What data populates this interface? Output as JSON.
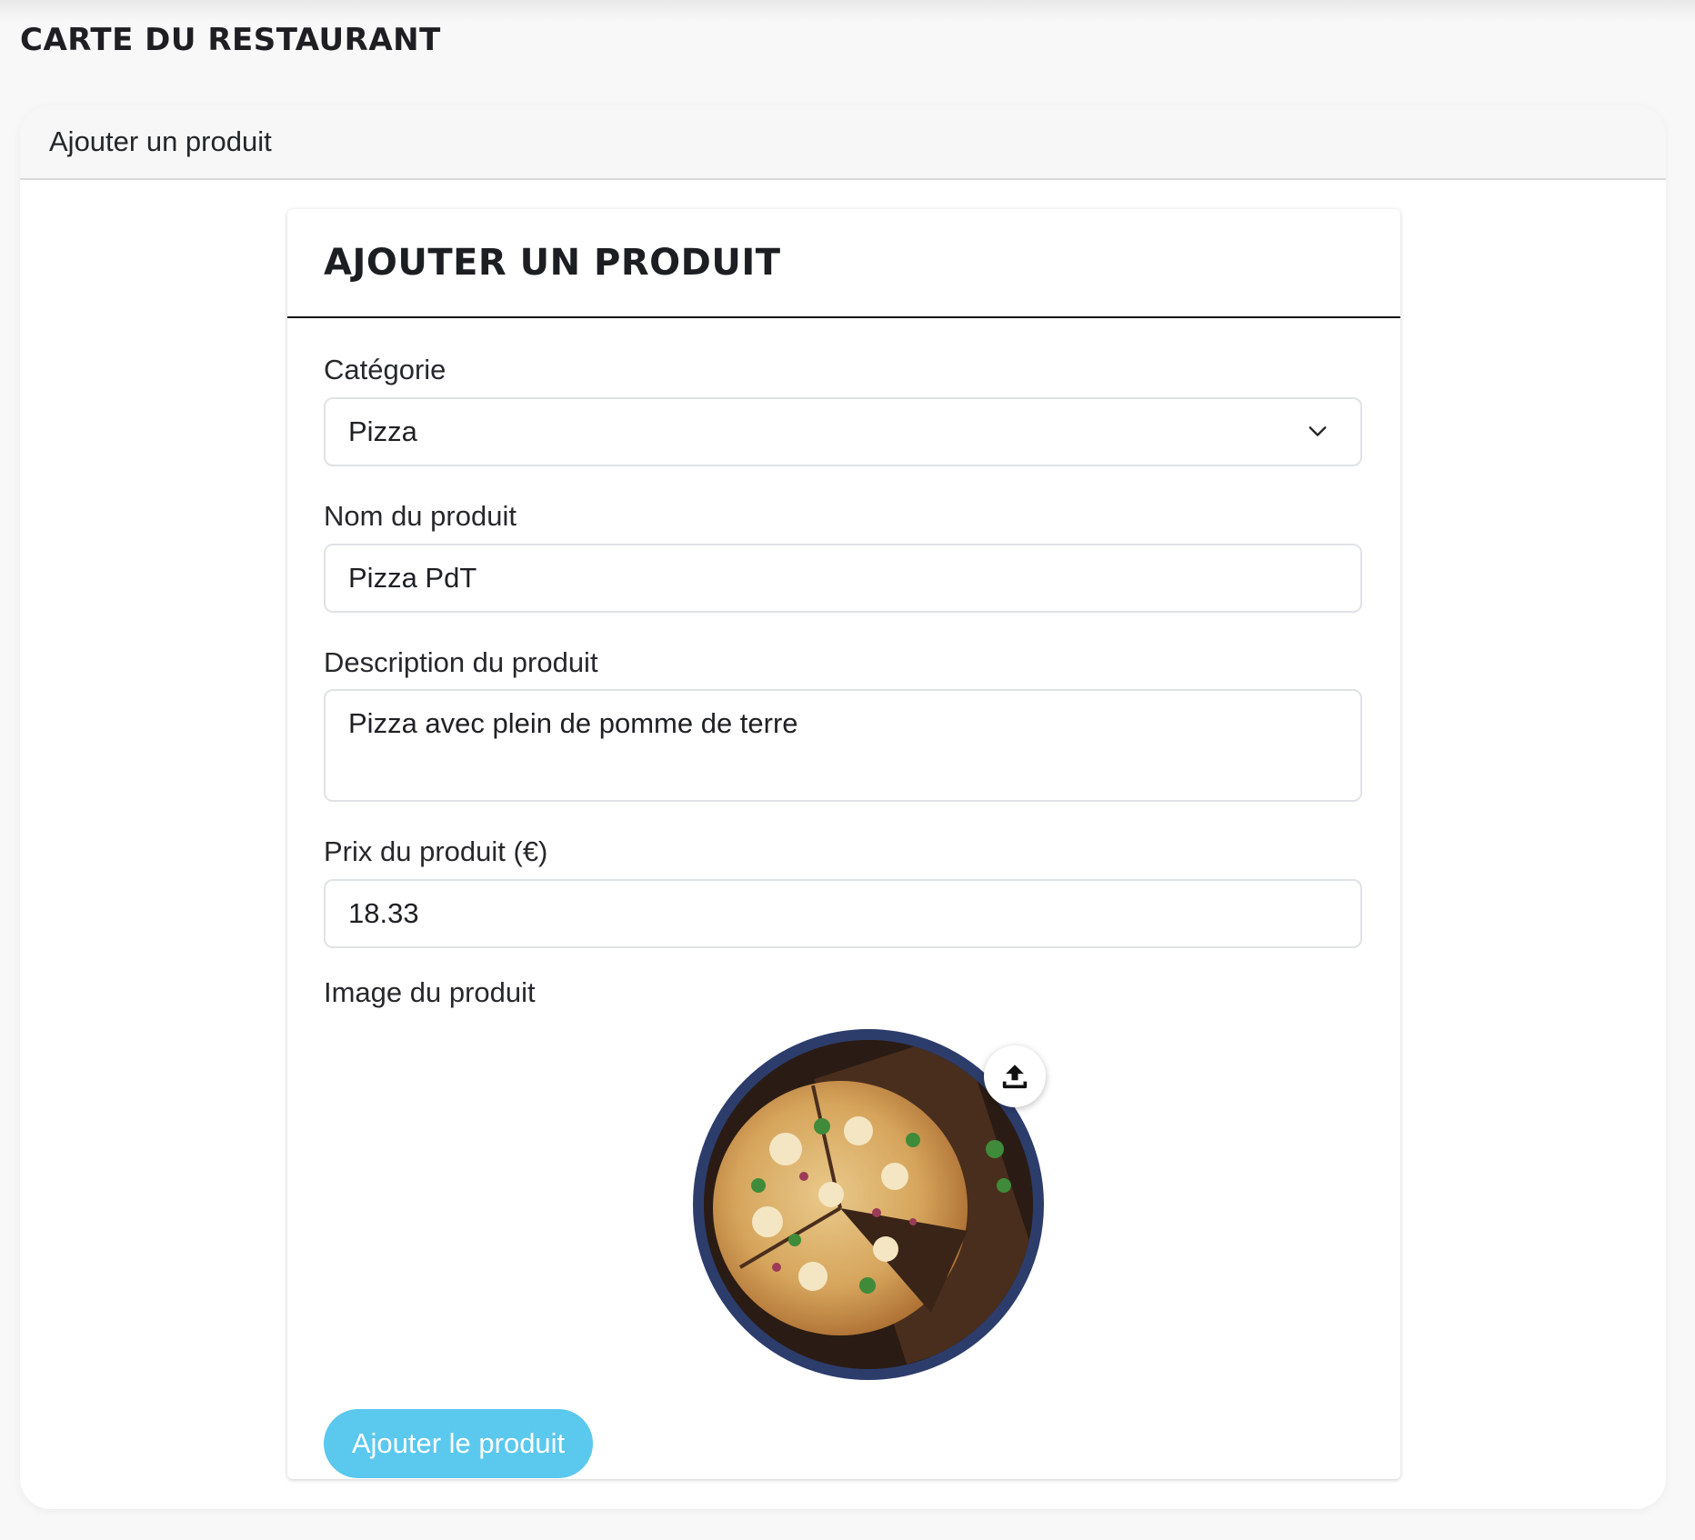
{
  "page": {
    "title": "CARTE DU RESTAURANT"
  },
  "outer_card": {
    "header_title": "Ajouter un produit"
  },
  "form": {
    "title": "AJOUTER UN PRODUIT",
    "category": {
      "label": "Catégorie",
      "value": "Pizza"
    },
    "name": {
      "label": "Nom du produit",
      "value": "Pizza PdT"
    },
    "description": {
      "label": "Description du produit",
      "value": "Pizza avec plein de pomme de terre"
    },
    "price": {
      "label": "Prix du produit (€)",
      "value": "18.33"
    },
    "image": {
      "label": "Image du produit",
      "upload_icon": "upload-icon"
    },
    "submit_label": "Ajouter le produit"
  },
  "colors": {
    "submit_button": "#5bc8ee",
    "avatar_border": "#2c3d6c"
  }
}
